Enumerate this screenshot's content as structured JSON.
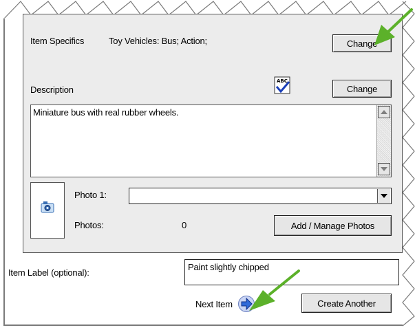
{
  "item_specifics": {
    "label": "Item Specifics",
    "value": "Toy Vehicles: Bus; Action;",
    "change_button": "Change"
  },
  "description": {
    "label": "Description",
    "spellcheck_icon": "spellcheck-abc-icon",
    "change_button": "Change",
    "text": "Miniature bus with real rubber wheels."
  },
  "photos": {
    "photo1_label": "Photo 1:",
    "photo1_value": "",
    "photos_label": "Photos:",
    "photos_count": "0",
    "add_manage_button": "Add / Manage Photos",
    "camera_icon": "camera-icon"
  },
  "item_label": {
    "label": "Item Label (optional):",
    "value": "Paint slightly chipped"
  },
  "footer": {
    "next_item_label": "Next Item",
    "next_icon": "arrow-right-icon",
    "create_another_button": "Create Another"
  },
  "colors": {
    "panel_bg": "#ececec",
    "button_bg": "#e6e6e6",
    "pointer_arrow": "#5cb12a",
    "next_arrow": "#2f6ad9"
  }
}
